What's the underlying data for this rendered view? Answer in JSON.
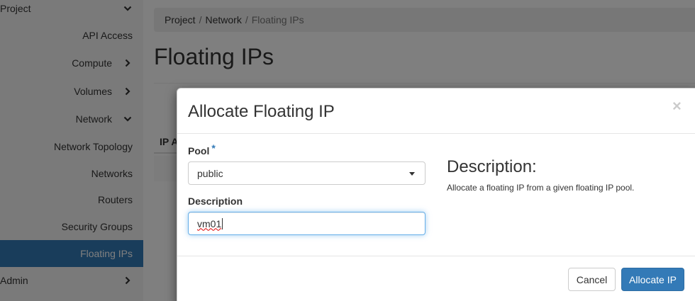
{
  "sidebar": {
    "items": [
      {
        "label": "Project",
        "chevron": "chevron-down"
      },
      {
        "label": "API Access"
      },
      {
        "label": "Compute",
        "chevron": "chevron-right"
      },
      {
        "label": "Volumes",
        "chevron": "chevron-right"
      },
      {
        "label": "Network",
        "chevron": "chevron-down"
      },
      {
        "label": "Network Topology"
      },
      {
        "label": "Networks"
      },
      {
        "label": "Routers"
      },
      {
        "label": "Security Groups"
      },
      {
        "label": "Floating IPs",
        "active": true
      },
      {
        "label": "Admin",
        "chevron": "chevron-right"
      }
    ]
  },
  "breadcrumb": {
    "items": [
      "Project",
      "Network",
      "Floating IPs"
    ],
    "separator": "/"
  },
  "page": {
    "title": "Floating IPs",
    "table_header_partial": "IP A"
  },
  "modal": {
    "title": "Allocate Floating IP",
    "close_symbol": "×",
    "pool_label": "Pool",
    "required_marker": "*",
    "pool_value": "public",
    "description_label": "Description",
    "description_value": "vm01",
    "help_heading": "Description:",
    "help_text": "Allocate a floating IP from a given floating IP pool.",
    "cancel_label": "Cancel",
    "submit_label": "Allocate IP"
  },
  "colors": {
    "accent": "#337ab7",
    "sidebar_bg": "#f5f5f5",
    "backdrop": "rgba(0,0,0,0.5)"
  }
}
